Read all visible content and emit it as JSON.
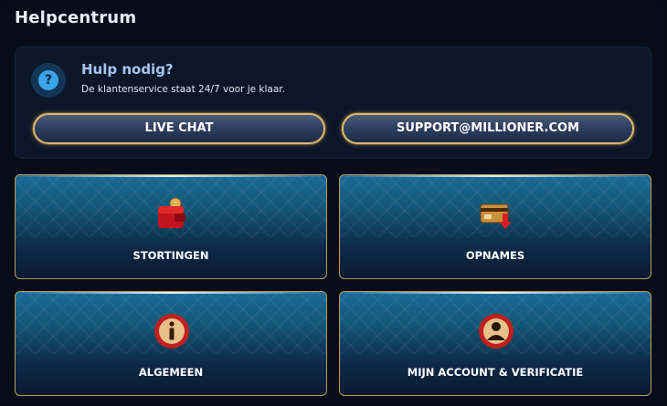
{
  "header": {
    "title": "Helpcentrum"
  },
  "help": {
    "title": "Hulp nodig?",
    "subtitle": "De klantenservice staat 24/7 voor je klaar.",
    "icon": "question-icon",
    "buttons": {
      "live_chat": "LIVE CHAT",
      "email": "SUPPORT@MILLIONER.COM"
    }
  },
  "categories": [
    {
      "label": "STORTINGEN",
      "icon": "wallet-icon"
    },
    {
      "label": "OPNAMES",
      "icon": "card-withdraw-icon"
    },
    {
      "label": "ALGEMEEN",
      "icon": "info-icon"
    },
    {
      "label": "MIJN ACCOUNT & VERIFICATIE",
      "icon": "account-icon"
    }
  ],
  "colors": {
    "background": "#070d18",
    "accent_gold": "#d9b870",
    "card_blue": "#1b6a94",
    "help_title": "#a9c6ee"
  }
}
